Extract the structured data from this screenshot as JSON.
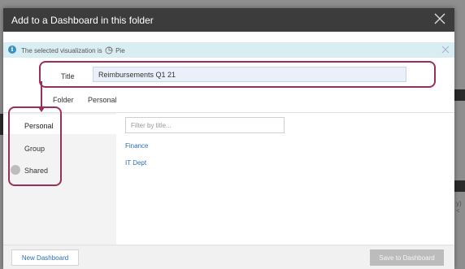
{
  "dialog": {
    "title": "Add to a Dashboard in this folder"
  },
  "info": {
    "prefix": "The selected visualization is",
    "chart_type": "Pie"
  },
  "form": {
    "title_label": "Title",
    "title_value": "Reimbursements Q1 21",
    "folder_label": "Folder",
    "folder_value": "Personal"
  },
  "sidebar": {
    "items": [
      {
        "label": "Personal",
        "active": true
      },
      {
        "label": "Group"
      },
      {
        "label": "Shared",
        "badge": ""
      }
    ]
  },
  "filter": {
    "placeholder": "Filter by title..."
  },
  "dashboards": [
    {
      "label": "Finance"
    },
    {
      "label": "IT Dept"
    }
  ],
  "footer": {
    "new_label": "New Dashboard",
    "save_label": "Save to Dashboard"
  },
  "colors": {
    "header": "#3c3c3c",
    "info_bar": "#d9eef2",
    "highlight": "#9a2f5c",
    "link": "#2a6fb5"
  },
  "background": {
    "right_fragment": "y) <"
  }
}
